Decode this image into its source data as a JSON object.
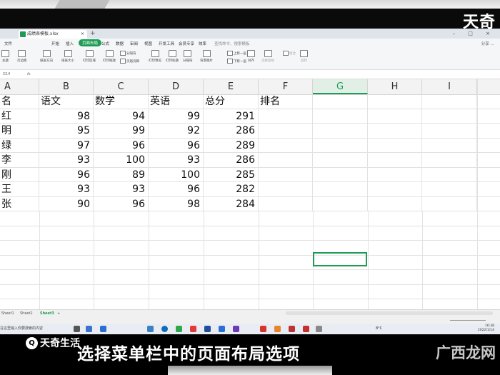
{
  "overlay": {
    "brand": "天奇",
    "logo_mark": "Q",
    "logo_text": "天奇生活",
    "caption": "选择菜单栏中的页面布局选项",
    "watermark": "广西龙网"
  },
  "window": {
    "file_name": "成绩表模板.xlsx",
    "tab_close": "×",
    "tab_add": "+",
    "controls": "– □ ×"
  },
  "menu": {
    "items": [
      "文件",
      "开始",
      "插入",
      "页面布局",
      "公式",
      "数据",
      "审阅",
      "视图",
      "开发工具",
      "会员专享",
      "效率"
    ],
    "active_index": 3,
    "search_placeholder": "查找命令、搜索模板",
    "right": "分享  …"
  },
  "ribbon": {
    "big": [
      "主题",
      "页边距",
      "纸张方向",
      "纸张大小",
      "打印区域",
      "打印缩放",
      "打印预览",
      "打印标题",
      "分隔符",
      "背景图片",
      "对齐",
      "选择窗格",
      "旋转"
    ],
    "small": [
      "分隔符",
      "页眉页脚",
      "上移一层",
      "下移一层",
      "组合"
    ],
    "accent": "#1e9c55"
  },
  "formula": {
    "cell_ref": "G14",
    "fx": "fx"
  },
  "grid": {
    "columns": [
      "A",
      "B",
      "C",
      "D",
      "E",
      "F",
      "G",
      "H",
      "I"
    ],
    "selected_column": "G",
    "header_row": [
      "名",
      "语文",
      "数学",
      "英语",
      "总分",
      "排名"
    ],
    "rows": [
      [
        "红",
        "98",
        "94",
        "99",
        "291",
        ""
      ],
      [
        "明",
        "95",
        "99",
        "92",
        "286",
        ""
      ],
      [
        "绿",
        "97",
        "96",
        "96",
        "289",
        ""
      ],
      [
        "李",
        "93",
        "100",
        "93",
        "286",
        ""
      ],
      [
        "刚",
        "96",
        "89",
        "100",
        "285",
        ""
      ],
      [
        "王",
        "93",
        "93",
        "96",
        "282",
        ""
      ],
      [
        "张",
        "90",
        "96",
        "98",
        "284",
        ""
      ]
    ]
  },
  "sheets": [
    "Sheet1",
    "Sheet2",
    "Sheet3"
  ],
  "active_sheet": "Sheet3",
  "sheet_add": "+",
  "taskbar": {
    "search_text": "在这里输入你要搜索的内容",
    "weather": "8°C",
    "time": "16:38",
    "date": "2022/1/14"
  }
}
